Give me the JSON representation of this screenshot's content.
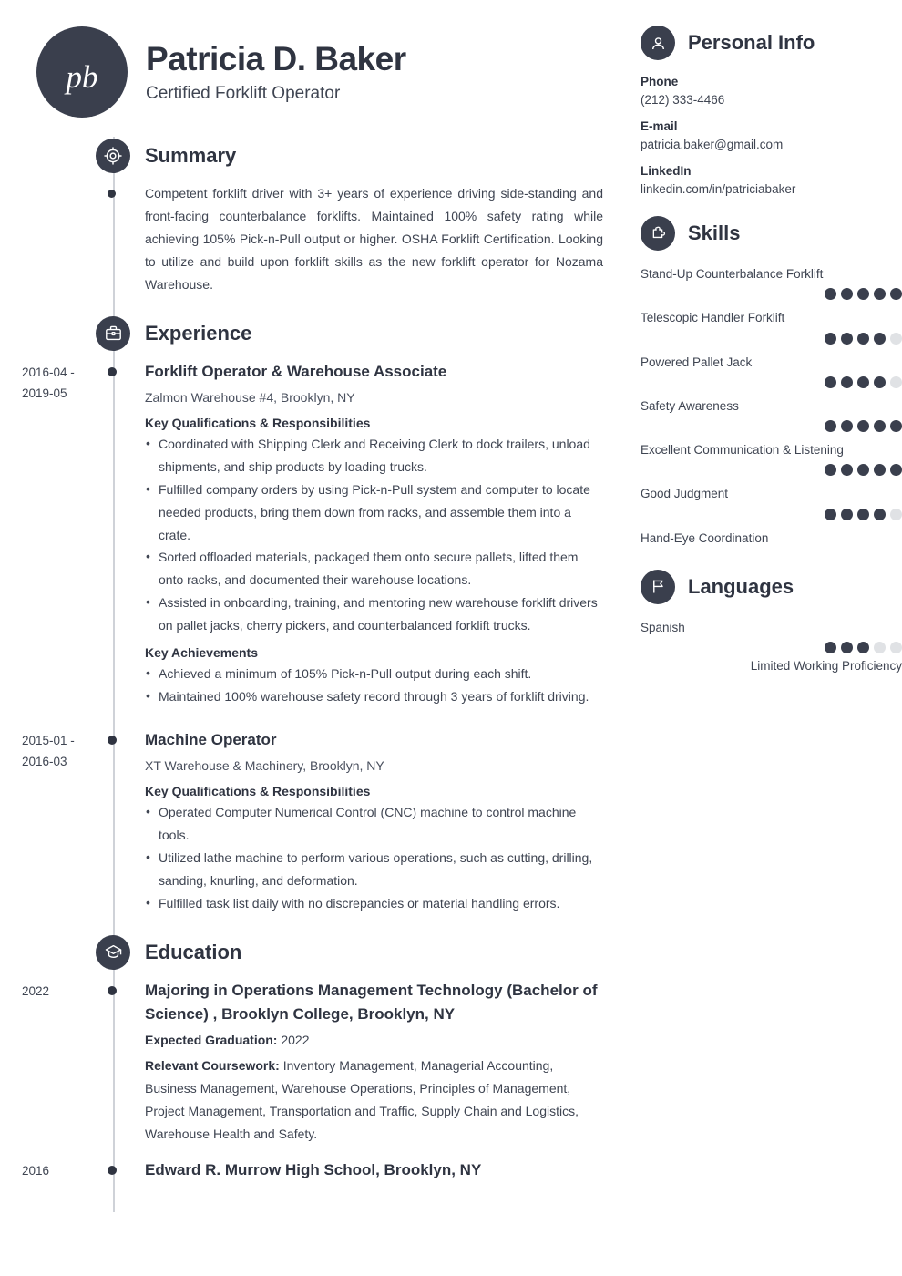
{
  "header": {
    "initials": "pb",
    "name": "Patricia D. Baker",
    "job_title": "Certified Forklift Operator"
  },
  "theme": {
    "dark": "#3a3f4d",
    "dot_empty": "#e0e2e5",
    "rail": "#cfd2d8"
  },
  "sections": {
    "summary": {
      "title": "Summary",
      "icon": "target-icon",
      "text": "Competent forklift driver with 3+ years of experience driving side-standing and front-facing counterbalance forklifts. Maintained 100% safety rating while achieving 105% Pick-n-Pull output or higher. OSHA Forklift Certification. Looking to utilize and build upon forklift skills as the new forklift operator for Nozama Warehouse."
    },
    "experience": {
      "title": "Experience",
      "icon": "briefcase-icon",
      "entries": [
        {
          "date": "2016-04 - 2019-05",
          "title": "Forklift Operator & Warehouse Associate",
          "subtitle": "Zalmon Warehouse #4, Brooklyn, NY",
          "qualifications_label": "Key Qualifications & Responsibilities",
          "qualifications": [
            "Coordinated with Shipping Clerk and Receiving Clerk to dock trailers, unload shipments, and ship products by loading trucks.",
            "Fulfilled company orders by using Pick-n-Pull system and computer to locate needed products, bring them down from racks, and assemble them into a crate.",
            "Sorted offloaded materials, packaged them onto secure pallets, lifted them onto racks, and documented their warehouse locations.",
            "Assisted in onboarding, training, and mentoring new warehouse forklift drivers on pallet jacks, cherry pickers, and counterbalanced forklift trucks."
          ],
          "achievements_label": "Key Achievements",
          "achievements": [
            "Achieved a minimum of 105% Pick-n-Pull output during each shift.",
            "Maintained 100% warehouse safety record through 3 years of forklift driving."
          ]
        },
        {
          "date": "2015-01 - 2016-03",
          "title": "Machine Operator",
          "subtitle": "XT Warehouse & Machinery, Brooklyn, NY",
          "qualifications_label": "Key Qualifications & Responsibilities",
          "qualifications": [
            "Operated Computer Numerical Control (CNC) machine to control machine tools.",
            "Utilized lathe machine to perform various operations, such as cutting, drilling, sanding, knurling, and deformation.",
            "Fulfilled task list daily with no discrepancies or material handling errors."
          ]
        }
      ]
    },
    "education": {
      "title": "Education",
      "icon": "graduation-cap-icon",
      "entries": [
        {
          "date": "2022",
          "title": "Majoring in Operations Management Technology (Bachelor of Science) , Brooklyn College, Brooklyn, NY",
          "graduation_label": "Expected Graduation:",
          "graduation_value": "2022",
          "coursework_label": "Relevant Coursework:",
          "coursework_value": "Inventory Management, Managerial Accounting, Business Management, Warehouse Operations, Principles of Management, Project Management, Transportation and Traffic, Supply Chain and Logistics, Warehouse Health and Safety."
        },
        {
          "date": "2016",
          "title": "Edward R. Murrow High School, Brooklyn, NY"
        }
      ]
    }
  },
  "sidebar": {
    "personal_info": {
      "title": "Personal Info",
      "icon": "user-icon",
      "fields": [
        {
          "label": "Phone",
          "value": "(212) 333-4466"
        },
        {
          "label": "E-mail",
          "value": "patricia.baker@gmail.com"
        },
        {
          "label": "LinkedIn",
          "value": "linkedin.com/in/patriciabaker"
        }
      ]
    },
    "skills": {
      "title": "Skills",
      "icon": "puzzle-icon",
      "max_rating": 5,
      "items": [
        {
          "name": "Stand-Up Counterbalance Forklift",
          "rating": 5
        },
        {
          "name": "Telescopic Handler Forklift",
          "rating": 4
        },
        {
          "name": "Powered Pallet Jack",
          "rating": 4
        },
        {
          "name": "Safety Awareness",
          "rating": 5
        },
        {
          "name": "Excellent Communication & Listening",
          "rating": 5
        },
        {
          "name": "Good Judgment",
          "rating": 4
        },
        {
          "name": "Hand-Eye Coordination",
          "rating": 0
        }
      ]
    },
    "languages": {
      "title": "Languages",
      "icon": "flag-icon",
      "max_rating": 5,
      "items": [
        {
          "name": "Spanish",
          "rating": 3,
          "level": "Limited Working Proficiency"
        }
      ]
    }
  }
}
